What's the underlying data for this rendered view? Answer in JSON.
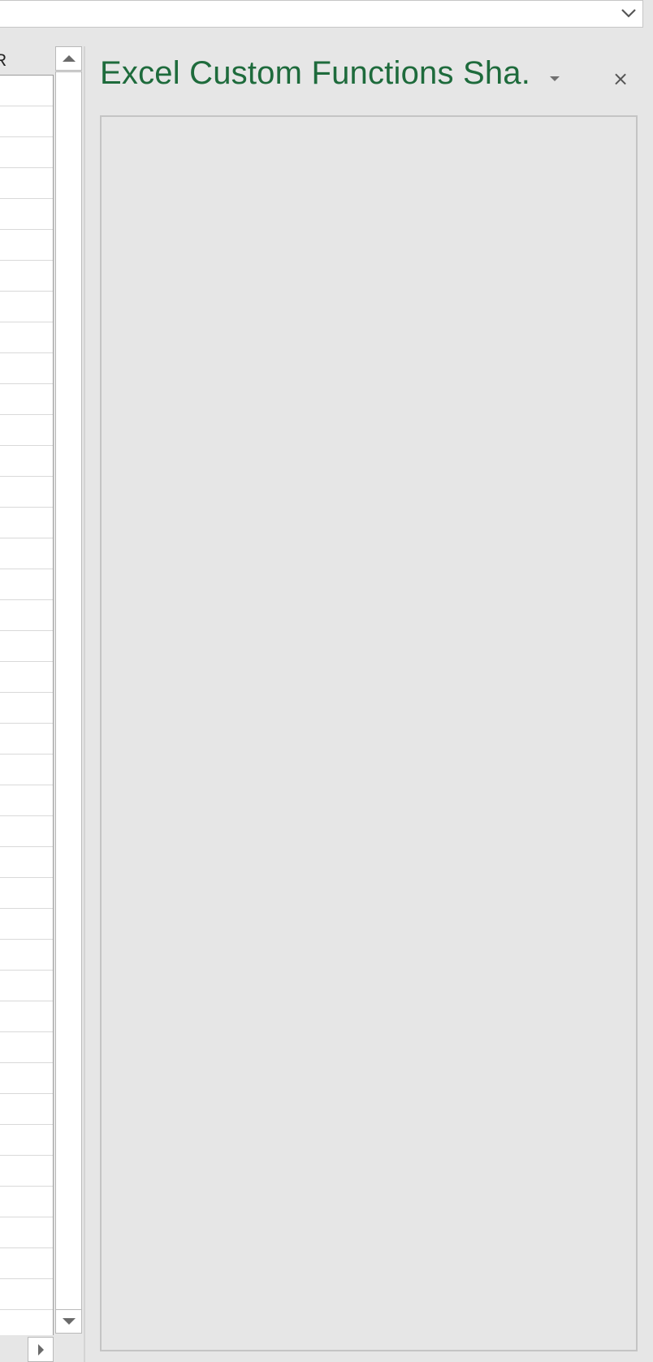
{
  "formula_bar": {
    "expand_icon": "chevron-down-icon"
  },
  "worksheet": {
    "column_header": "R",
    "row_count": 40
  },
  "task_pane": {
    "title": "Excel Custom Functions Sha.",
    "options_icon": "triangle-down-icon",
    "close_glyph": "×",
    "title_color": "#1e6b3c"
  },
  "scrollbar": {
    "up_icon": "triangle-up-icon",
    "down_icon": "triangle-down-icon",
    "right_icon": "triangle-right-icon"
  }
}
